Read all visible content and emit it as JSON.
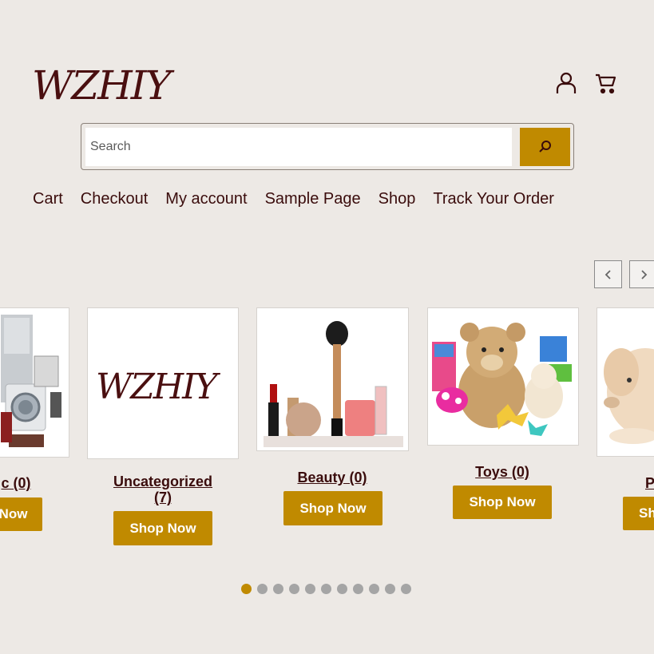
{
  "brand": {
    "logo_text": "WZHIY",
    "accent_color": "#c08a00",
    "text_color": "#3a0c0c"
  },
  "header": {
    "account_icon": "user-icon",
    "cart_icon": "cart-icon"
  },
  "search": {
    "placeholder": "Search",
    "value": "",
    "button_icon": "search-icon"
  },
  "nav": [
    "Cart",
    "Checkout",
    "My account",
    "Sample Page",
    "Shop",
    "Track Your Order"
  ],
  "carousel": {
    "prev_icon": "chevron-left-icon",
    "next_icon": "chevron-right-icon",
    "cards": [
      {
        "title": "c (0)",
        "button": "Now",
        "image": "electronics-appliances"
      },
      {
        "title": "Uncategorized (7)",
        "button": "Shop Now",
        "image": "wzhiy-logo"
      },
      {
        "title": "Beauty (0)",
        "button": "Shop Now",
        "image": "cosmetics"
      },
      {
        "title": "Toys (0)",
        "button": "Shop Now",
        "image": "toys"
      },
      {
        "title": "P",
        "button": "Sh",
        "image": "puppy"
      }
    ],
    "dots_count": 11,
    "active_dot": 1
  }
}
